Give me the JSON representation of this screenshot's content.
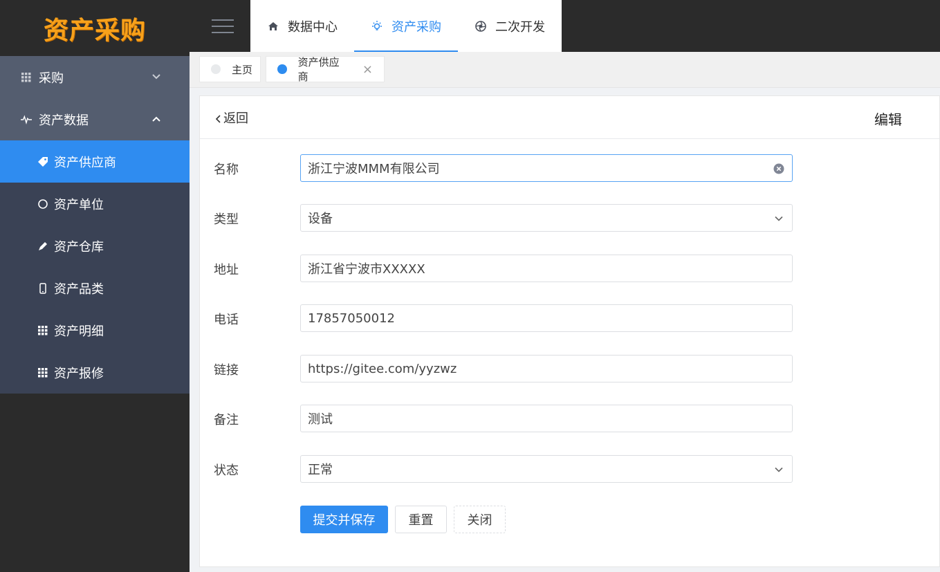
{
  "app": {
    "logo_text": "资产采购"
  },
  "sidebar": {
    "groups": [
      {
        "label": "采购",
        "icon": "grid-icon",
        "expanded": false
      },
      {
        "label": "资产数据",
        "icon": "activity-icon",
        "expanded": true
      }
    ],
    "items": [
      {
        "label": "资产供应商",
        "icon": "tag-icon",
        "active": true
      },
      {
        "label": "资产单位",
        "icon": "circle-icon"
      },
      {
        "label": "资产仓库",
        "icon": "pen-icon"
      },
      {
        "label": "资产品类",
        "icon": "phone-icon"
      },
      {
        "label": "资产明细",
        "icon": "grid-icon"
      },
      {
        "label": "资产报修",
        "icon": "grid-icon"
      }
    ]
  },
  "topnav": {
    "items": [
      {
        "label": "数据中心",
        "icon": "home-icon"
      },
      {
        "label": "资产采购",
        "icon": "bulb-icon",
        "active": true
      },
      {
        "label": "二次开发",
        "icon": "aperture-icon"
      }
    ]
  },
  "tabs": [
    {
      "label": "主页",
      "dot_color": "#e8eaec"
    },
    {
      "label": "资产供应商",
      "dot_color": "#2d8cf0",
      "closable": true,
      "close_glyph": "×"
    }
  ],
  "page": {
    "back_label": "返回",
    "title": "编辑"
  },
  "form": {
    "fields": [
      {
        "label": "名称",
        "value": "浙江宁波MMM有限公司",
        "type": "input",
        "clearable": true
      },
      {
        "label": "类型",
        "value": "设备",
        "type": "select"
      },
      {
        "label": "地址",
        "value": "浙江省宁波市XXXXX",
        "type": "input"
      },
      {
        "label": "电话",
        "value": "17857050012",
        "type": "input"
      },
      {
        "label": "链接",
        "value": "https://gitee.com/yyzwz",
        "type": "input"
      },
      {
        "label": "备注",
        "value": "测试",
        "type": "input"
      },
      {
        "label": "状态",
        "value": "正常",
        "type": "select"
      }
    ],
    "buttons": {
      "submit": "提交并保存",
      "reset": "重置",
      "close": "关闭"
    }
  },
  "colors": {
    "primary": "#2f8cf0",
    "sidebar_bg": "#2b2b2b",
    "submenu_bg": "#3a4255",
    "group_bg": "#545d6f",
    "logo": "#f7a11b"
  }
}
